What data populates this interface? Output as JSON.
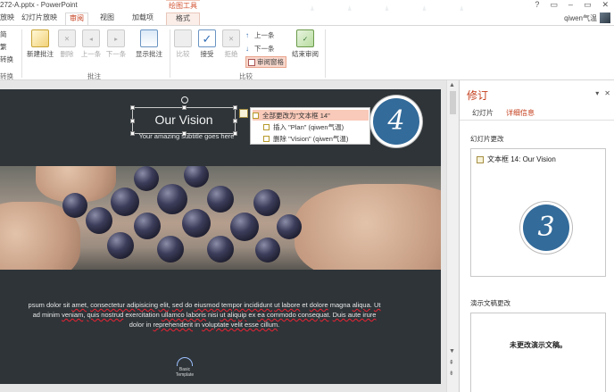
{
  "window": {
    "title": "272-A.pptx - PowerPoint",
    "context_tab_header": "绘图工具",
    "win_buttons": [
      "?",
      "▭",
      "–",
      "▭",
      "✕"
    ]
  },
  "tabs": [
    {
      "label": "片放映"
    },
    {
      "label": "幻灯片放映"
    },
    {
      "label": "审阅",
      "active": true
    },
    {
      "label": "视图"
    },
    {
      "label": "加载项"
    },
    {
      "label": "格式",
      "contextual": true
    }
  ],
  "user": {
    "name": "qiwen气温"
  },
  "ribbon": {
    "left_partial": [
      "简",
      "繁",
      "转换",
      "转换"
    ],
    "new_comment": "新建批注",
    "delete": "删除",
    "prev": "上一条",
    "next": "下一条",
    "show_comments": "显示批注",
    "comments_group": "批注",
    "compare": "比较",
    "accept": "接受",
    "reject": "拒绝",
    "prev_change": "上一条",
    "next_change": "下一条",
    "review_pane": "审阅窗格",
    "end_review": "结束审阅",
    "compare_group": "比较"
  },
  "slide": {
    "title": "Our Vision",
    "subtitle": "Your amazing subtitle goes here",
    "body_lines": [
      [
        {
          "t": "psum dolor sit "
        },
        {
          "t": "amet",
          "err": true
        },
        {
          "t": ", "
        },
        {
          "t": "consectetur adipisicing elit",
          "err": true
        },
        {
          "t": ", "
        },
        {
          "t": "sed",
          "err": true
        },
        {
          "t": " do "
        },
        {
          "t": "eiusmod tempor incididunt",
          "err": true
        },
        {
          "t": " "
        },
        {
          "t": "ut labore",
          "err": true
        },
        {
          "t": " et "
        },
        {
          "t": "dolore",
          "err": true
        },
        {
          "t": " magna "
        },
        {
          "t": "aliqua",
          "err": true
        },
        {
          "t": ". "
        },
        {
          "t": "Ut",
          "err": true
        }
      ],
      [
        {
          "t": "ad minim "
        },
        {
          "t": "veniam",
          "err": true
        },
        {
          "t": ", "
        },
        {
          "t": "quis nostrud",
          "err": true
        },
        {
          "t": " exercitation "
        },
        {
          "t": "ullamco laboris",
          "err": true
        },
        {
          "t": " nisi "
        },
        {
          "t": "ut aliquip",
          "err": true
        },
        {
          "t": " ex "
        },
        {
          "t": "ea commodo consequat",
          "err": true
        },
        {
          "t": ". "
        },
        {
          "t": "Duis aute irure",
          "err": true
        }
      ],
      [
        {
          "t": "dolor in "
        },
        {
          "t": "reprehenderit",
          "err": true
        },
        {
          "t": " in "
        },
        {
          "t": "voluptate velit esse cillum",
          "err": true
        },
        {
          "t": "."
        }
      ]
    ],
    "logo_text": "Basic Template"
  },
  "changes_popup": [
    {
      "label": "全部更改为\"文本框 14\"",
      "highlight": true
    },
    {
      "label": "插入 \"Plan\" (qiwen气温)"
    },
    {
      "label": "删除 \"Vision\" (qiwen气温)"
    }
  ],
  "badges": {
    "popup_badge": "4",
    "pane_badge": "3"
  },
  "pane": {
    "title": "修订",
    "tab_slides": "幻灯片",
    "tab_details": "详细信息",
    "slide_changes_label": "幻灯片更改",
    "slide_change_item": "文本框 14: Our Vision",
    "presentation_changes_label": "演示文稿更改",
    "no_presentation_changes": "未更改演示文稿。",
    "controls": [
      "▾",
      "✕"
    ]
  },
  "colors": {
    "accent": "#c43e1c",
    "slide_bg": "#2e3438",
    "badge": "#336b9a",
    "highlight": "#f9c9b9"
  }
}
